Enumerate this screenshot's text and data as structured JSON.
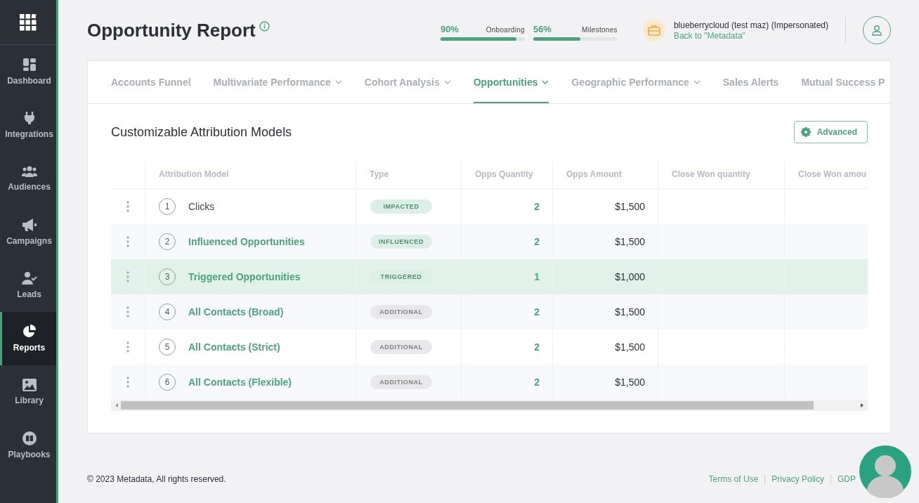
{
  "sidebar": {
    "items": [
      {
        "label": "Dashboard",
        "selected": false
      },
      {
        "label": "Integrations",
        "selected": false
      },
      {
        "label": "Audiences",
        "selected": false
      },
      {
        "label": "Campaigns",
        "selected": false
      },
      {
        "label": "Leads",
        "selected": false
      },
      {
        "label": "Reports",
        "selected": true
      },
      {
        "label": "Library",
        "selected": false
      },
      {
        "label": "Playbooks",
        "selected": false
      }
    ]
  },
  "page_title": "Opportunity Report",
  "progress": [
    {
      "reading": "90%",
      "label": "Onboarding",
      "level": 0.9
    },
    {
      "reading": "56%",
      "label": "Milestones",
      "level": 0.56
    }
  ],
  "account": {
    "name": "blueberrycloud (test maz) (Impersonated)",
    "back_link": "Back to \"Metadata\""
  },
  "tabs": [
    {
      "label": "Accounts Funnel",
      "dropdown": false,
      "selected": false
    },
    {
      "label": "Multivariate Performance",
      "dropdown": true,
      "selected": false
    },
    {
      "label": "Cohort Analysis",
      "dropdown": true,
      "selected": false
    },
    {
      "label": "Opportunities",
      "dropdown": true,
      "selected": true
    },
    {
      "label": "Geographic Performance",
      "dropdown": true,
      "selected": false
    },
    {
      "label": "Sales Alerts",
      "dropdown": false,
      "selected": false
    },
    {
      "label": "Mutual Success P",
      "dropdown": false,
      "selected": false
    }
  ],
  "section_title": "Customizable Attribution Models",
  "advanced_button": "Advanced",
  "table": {
    "columns": [
      "Attribution Model",
      "Type",
      "Opps Quantity",
      "Opps Amount",
      "Close Won quantity",
      "Close Won amou"
    ],
    "rows": [
      {
        "number": "1",
        "model": "Clicks",
        "link": false,
        "type": {
          "label": "IMPACTED",
          "color": "#dcefe6"
        },
        "opps_quantity": "2",
        "opps_amount": "$1,500",
        "highlighted": false
      },
      {
        "number": "2",
        "model": "Influenced Opportunities",
        "link": true,
        "type": {
          "label": "INFLUENCED",
          "color": "#dcefe6"
        },
        "opps_quantity": "2",
        "opps_amount": "$1,500",
        "highlighted": false
      },
      {
        "number": "3",
        "model": "Triggered Opportunities",
        "link": true,
        "type": {
          "label": "TRIGGERED",
          "color": "#dcefe6"
        },
        "opps_quantity": "1",
        "opps_amount": "$1,000",
        "highlighted": true
      },
      {
        "number": "4",
        "model": "All Contacts (Broad)",
        "link": true,
        "type": {
          "label": "ADDITIONAL",
          "color": "#e8e8ea"
        },
        "opps_quantity": "2",
        "opps_amount": "$1,500",
        "highlighted": false
      },
      {
        "number": "5",
        "model": "All Contacts (Strict)",
        "link": true,
        "type": {
          "label": "ADDITIONAL",
          "color": "#e8e8ea"
        },
        "opps_quantity": "2",
        "opps_amount": "$1,500",
        "highlighted": false
      },
      {
        "number": "6",
        "model": "All Contacts (Flexible)",
        "link": true,
        "type": {
          "label": "ADDITIONAL",
          "color": "#e8e8ea"
        },
        "opps_quantity": "2",
        "opps_amount": "$1,500",
        "highlighted": false
      }
    ]
  },
  "footer": {
    "copyright": "© 2023 Metadata, All rights reserved.",
    "links": [
      "Terms of Use",
      "Privacy Policy",
      "GDP"
    ]
  }
}
